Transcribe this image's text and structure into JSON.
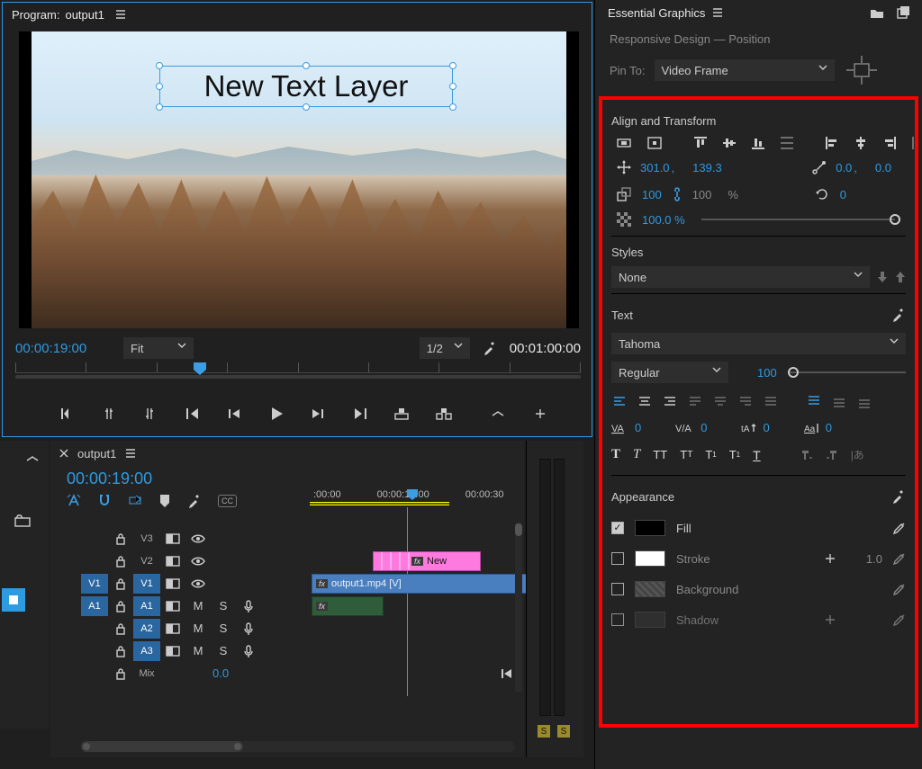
{
  "program": {
    "title_prefix": "Program:",
    "title_name": "output1",
    "text_layer": "New Text Layer",
    "timecode_current": "00:00:19:00",
    "fit_label": "Fit",
    "scale_label": "1/2",
    "timecode_total": "00:01:00:00"
  },
  "timeline": {
    "tab_name": "output1",
    "timecode": "00:00:19:00",
    "ruler": [
      ":00:00",
      "00:00:15:00",
      "00:00:30"
    ],
    "tracks": {
      "v3": "V3",
      "v2": "V2",
      "v1": "V1",
      "a1": "A1",
      "a2": "A2",
      "a3": "A3",
      "mix": "Mix"
    },
    "mix_value": "0.0",
    "clip_v2_fx": "fx",
    "clip_v2_label": "New",
    "clip_v1_fx": "fx",
    "clip_v1_label": "output1.mp4 [V]",
    "clip_a1_fx": "fx",
    "audio_meter_label": "S"
  },
  "right": {
    "panel_title": "Essential Graphics",
    "responsive_title": "Responsive Design — Position",
    "pin_to_label": "Pin To:",
    "pin_to_value": "Video Frame",
    "align_title": "Align and Transform",
    "pos_x": "301.0",
    "pos_sep": ",",
    "pos_y": "139.3",
    "anchor_x": "0.0",
    "anchor_sep": ",",
    "anchor_y": "0.0",
    "scale": "100",
    "scale_h": "100",
    "scale_pct": "%",
    "rot": "0",
    "opacity": "100.0 %",
    "styles_title": "Styles",
    "styles_value": "None",
    "text_title": "Text",
    "text_font": "Tahoma",
    "text_style": "Regular",
    "text_size": "100",
    "kerning": "0",
    "tracking": "0",
    "baseline": "0",
    "leading": "0",
    "appearance_title": "Appearance",
    "fill_label": "Fill",
    "stroke_label": "Stroke",
    "stroke_value": "1.0",
    "background_label": "Background",
    "shadow_label": "Shadow"
  }
}
